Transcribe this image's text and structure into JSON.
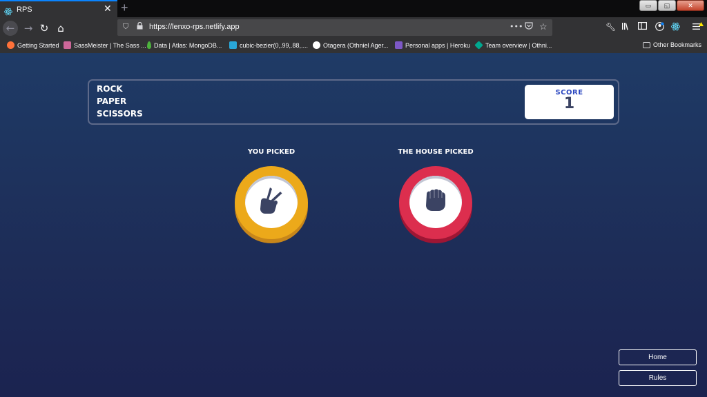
{
  "browser": {
    "tab_title": "RPS",
    "tab_close": "✕",
    "new_tab": "+",
    "url": "https://lenxo-rps.netlify.app",
    "window_controls": [
      "▭",
      "◱",
      "✕"
    ],
    "bookmarks": [
      {
        "label": "Getting Started",
        "color": "#ff7139"
      },
      {
        "label": "SassMeister | The Sass ...",
        "color": "#cd6799"
      },
      {
        "label": "Data | Atlas: MongoDB...",
        "color": "#4db33d"
      },
      {
        "label": "cubic-bezier(0,.99,.88,....",
        "color": "#29a7d8"
      },
      {
        "label": "Otagera (Othniel Ager...",
        "color": "#ffffff"
      },
      {
        "label": "Personal apps | Heroku",
        "color": "#7d58c6"
      },
      {
        "label": "Team overview | Othni...",
        "color": "#00a88f"
      }
    ],
    "other_bookmarks": "Other Bookmarks"
  },
  "game": {
    "title_lines": [
      "ROCK",
      "PAPER",
      "SCISSORS"
    ],
    "score_label": "SCORE",
    "score_value": "1",
    "you_picked_label": "YOU PICKED",
    "house_picked_label": "THE HOUSE PICKED",
    "player_choice": "scissors",
    "house_choice": "rock",
    "colors": {
      "scissors_ring": "#eca91a",
      "scissors_shadow": "#c7861a",
      "rock_ring": "#dc2e4e",
      "rock_shadow": "#9d1634",
      "icon": "#3b4363"
    }
  },
  "side_buttons": {
    "home": "Home",
    "rules": "Rules"
  }
}
